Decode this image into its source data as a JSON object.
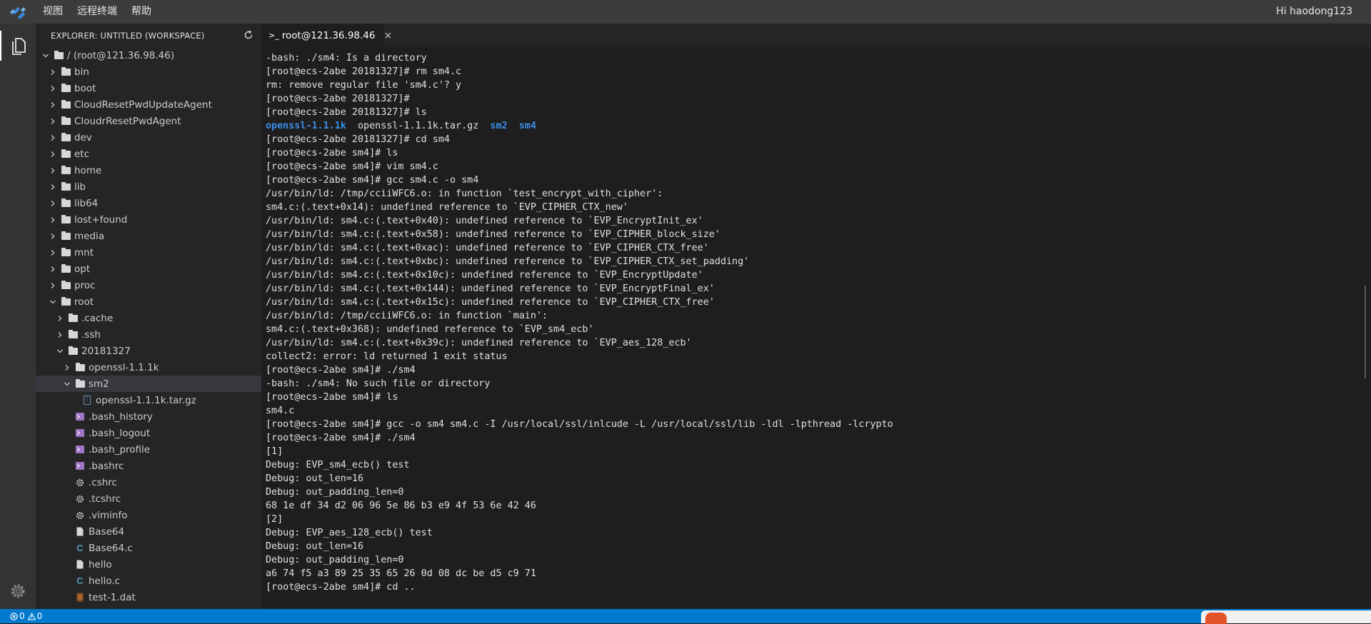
{
  "menubar": {
    "items": [
      "视图",
      "远程终端",
      "帮助"
    ],
    "user": "Hi haodong123"
  },
  "sidebar": {
    "title": "EXPLORER: UNTITLED (WORKSPACE)",
    "tree": [
      {
        "label": "/ (root@121.36.98.46)",
        "type": "folder",
        "depth": 0,
        "open": true
      },
      {
        "label": "bin",
        "type": "folder",
        "depth": 1,
        "open": false
      },
      {
        "label": "boot",
        "type": "folder",
        "depth": 1,
        "open": false
      },
      {
        "label": "CloudResetPwdUpdateAgent",
        "type": "folder",
        "depth": 1,
        "open": false
      },
      {
        "label": "CloudrResetPwdAgent",
        "type": "folder",
        "depth": 1,
        "open": false
      },
      {
        "label": "dev",
        "type": "folder",
        "depth": 1,
        "open": false
      },
      {
        "label": "etc",
        "type": "folder",
        "depth": 1,
        "open": false
      },
      {
        "label": "home",
        "type": "folder",
        "depth": 1,
        "open": false
      },
      {
        "label": "lib",
        "type": "folder",
        "depth": 1,
        "open": false
      },
      {
        "label": "lib64",
        "type": "folder",
        "depth": 1,
        "open": false
      },
      {
        "label": "lost+found",
        "type": "folder",
        "depth": 1,
        "open": false
      },
      {
        "label": "media",
        "type": "folder",
        "depth": 1,
        "open": false
      },
      {
        "label": "mnt",
        "type": "folder",
        "depth": 1,
        "open": false
      },
      {
        "label": "opt",
        "type": "folder",
        "depth": 1,
        "open": false
      },
      {
        "label": "proc",
        "type": "folder",
        "depth": 1,
        "open": false
      },
      {
        "label": "root",
        "type": "folder",
        "depth": 1,
        "open": true
      },
      {
        "label": ".cache",
        "type": "folder",
        "depth": 2,
        "open": false
      },
      {
        "label": ".ssh",
        "type": "folder",
        "depth": 2,
        "open": false
      },
      {
        "label": "20181327",
        "type": "folder",
        "depth": 2,
        "open": true
      },
      {
        "label": "openssl-1.1.1k",
        "type": "folder",
        "depth": 3,
        "open": false
      },
      {
        "label": "sm2",
        "type": "folder",
        "depth": 3,
        "open": true,
        "selected": true
      },
      {
        "label": "openssl-1.1.1k.tar.gz",
        "type": "archive",
        "depth": 4
      },
      {
        "label": ".bash_history",
        "type": "shell",
        "depth": 3
      },
      {
        "label": ".bash_logout",
        "type": "shell",
        "depth": 3
      },
      {
        "label": ".bash_profile",
        "type": "shell",
        "depth": 3
      },
      {
        "label": ".bashrc",
        "type": "shell",
        "depth": 3
      },
      {
        "label": ".cshrc",
        "type": "gear",
        "depth": 3
      },
      {
        "label": ".tcshrc",
        "type": "gear",
        "depth": 3
      },
      {
        "label": ".viminfo",
        "type": "gear",
        "depth": 3
      },
      {
        "label": "Base64",
        "type": "file",
        "depth": 3
      },
      {
        "label": "Base64.c",
        "type": "c",
        "depth": 3
      },
      {
        "label": "hello",
        "type": "file",
        "depth": 3
      },
      {
        "label": "hello.c",
        "type": "c",
        "depth": 3
      },
      {
        "label": "test-1.dat",
        "type": "dat",
        "depth": 3
      }
    ]
  },
  "tab": {
    "icon": ">_",
    "title": "root@121.36.98.46",
    "close": "×"
  },
  "terminal": {
    "lines": [
      [
        {
          "t": "-bash: ./sm4: Is a directory"
        }
      ],
      [
        {
          "t": "[root@ecs-2abe 20181327]# rm sm4.c"
        }
      ],
      [
        {
          "t": "rm: remove regular file 'sm4.c'? y"
        }
      ],
      [
        {
          "t": "[root@ecs-2abe 20181327]#"
        }
      ],
      [
        {
          "t": "[root@ecs-2abe 20181327]# ls"
        }
      ],
      [
        {
          "t": "openssl-1.1.1k",
          "c": "dir"
        },
        {
          "t": "  openssl-1.1.1k.tar.gz  "
        },
        {
          "t": "sm2",
          "c": "dir"
        },
        {
          "t": "  "
        },
        {
          "t": "sm4",
          "c": "dir"
        }
      ],
      [
        {
          "t": "[root@ecs-2abe 20181327]# cd sm4"
        }
      ],
      [
        {
          "t": "[root@ecs-2abe sm4]# ls"
        }
      ],
      [
        {
          "t": "[root@ecs-2abe sm4]# vim sm4.c"
        }
      ],
      [
        {
          "t": "[root@ecs-2abe sm4]# gcc sm4.c -o sm4"
        }
      ],
      [
        {
          "t": "/usr/bin/ld: /tmp/cciiWFC6.o: in function `test_encrypt_with_cipher':"
        }
      ],
      [
        {
          "t": "sm4.c:(.text+0x14): undefined reference to `EVP_CIPHER_CTX_new'"
        }
      ],
      [
        {
          "t": "/usr/bin/ld: sm4.c:(.text+0x40): undefined reference to `EVP_EncryptInit_ex'"
        }
      ],
      [
        {
          "t": "/usr/bin/ld: sm4.c:(.text+0x58): undefined reference to `EVP_CIPHER_block_size'"
        }
      ],
      [
        {
          "t": "/usr/bin/ld: sm4.c:(.text+0xac): undefined reference to `EVP_CIPHER_CTX_free'"
        }
      ],
      [
        {
          "t": "/usr/bin/ld: sm4.c:(.text+0xbc): undefined reference to `EVP_CIPHER_CTX_set_padding'"
        }
      ],
      [
        {
          "t": "/usr/bin/ld: sm4.c:(.text+0x10c): undefined reference to `EVP_EncryptUpdate'"
        }
      ],
      [
        {
          "t": "/usr/bin/ld: sm4.c:(.text+0x144): undefined reference to `EVP_EncryptFinal_ex'"
        }
      ],
      [
        {
          "t": "/usr/bin/ld: sm4.c:(.text+0x15c): undefined reference to `EVP_CIPHER_CTX_free'"
        }
      ],
      [
        {
          "t": "/usr/bin/ld: /tmp/cciiWFC6.o: in function `main':"
        }
      ],
      [
        {
          "t": "sm4.c:(.text+0x368): undefined reference to `EVP_sm4_ecb'"
        }
      ],
      [
        {
          "t": "/usr/bin/ld: sm4.c:(.text+0x39c): undefined reference to `EVP_aes_128_ecb'"
        }
      ],
      [
        {
          "t": "collect2: error: ld returned 1 exit status"
        }
      ],
      [
        {
          "t": "[root@ecs-2abe sm4]# ./sm4"
        }
      ],
      [
        {
          "t": "-bash: ./sm4: No such file or directory"
        }
      ],
      [
        {
          "t": "[root@ecs-2abe sm4]# ls"
        }
      ],
      [
        {
          "t": "sm4.c"
        }
      ],
      [
        {
          "t": "[root@ecs-2abe sm4]# gcc -o sm4 sm4.c -I /usr/local/ssl/inlcude -L /usr/local/ssl/lib -ldl -lpthread -lcrypto"
        }
      ],
      [
        {
          "t": "[root@ecs-2abe sm4]# ./sm4"
        }
      ],
      [
        {
          "t": "[1]"
        }
      ],
      [
        {
          "t": "Debug: EVP_sm4_ecb() test"
        }
      ],
      [
        {
          "t": "Debug: out_len=16"
        }
      ],
      [
        {
          "t": "Debug: out_padding_len=0"
        }
      ],
      [
        {
          "t": "68 1e df 34 d2 06 96 5e 86 b3 e9 4f 53 6e 42 46"
        }
      ],
      [
        {
          "t": "[2]"
        }
      ],
      [
        {
          "t": "Debug: EVP_aes_128_ecb() test"
        }
      ],
      [
        {
          "t": "Debug: out_len=16"
        }
      ],
      [
        {
          "t": "Debug: out_padding_len=0"
        }
      ],
      [
        {
          "t": "a6 74 f5 a3 89 25 35 65 26 0d 08 dc be d5 c9 71"
        }
      ],
      [
        {
          "t": "[root@ecs-2abe sm4]# cd .."
        }
      ]
    ]
  },
  "statusbar": {
    "errors": "0",
    "warnings": "0"
  },
  "colors": {
    "accent": "#007acc",
    "directory": "#3b8eea",
    "sidebar_bg": "#252526",
    "terminal_bg": "#1e1e1e"
  }
}
